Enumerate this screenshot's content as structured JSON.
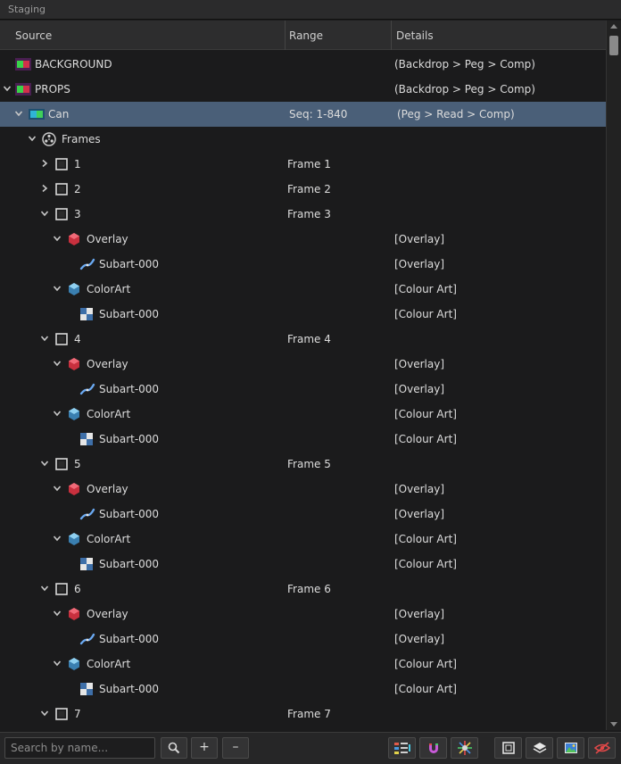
{
  "window": {
    "title": "Staging"
  },
  "columns": {
    "source": "Source",
    "range": "Range",
    "details": "Details"
  },
  "rows": [
    {
      "name": "BACKGROUND",
      "range": "",
      "details": "(Backdrop > Peg > Comp)",
      "icon": "element-color-icon",
      "chevron": "none",
      "depth": 0,
      "selected": false
    },
    {
      "name": "PROPS",
      "range": "",
      "details": "(Backdrop > Peg > Comp)",
      "icon": "element-color-icon",
      "chevron": "down",
      "depth": 0,
      "selected": false
    },
    {
      "name": "Can",
      "range": "Seq: 1-840",
      "details": "(Peg > Read > Comp)",
      "icon": "drawing-element-icon",
      "chevron": "down",
      "depth": 1,
      "selected": true
    },
    {
      "name": "Frames",
      "range": "",
      "details": "",
      "icon": "film-reel-icon",
      "chevron": "down",
      "depth": 2,
      "selected": false
    },
    {
      "name": "1",
      "range": "Frame 1",
      "details": "",
      "icon": "frame-icon",
      "chevron": "right",
      "depth": 3,
      "selected": false
    },
    {
      "name": "2",
      "range": "Frame 2",
      "details": "",
      "icon": "frame-icon",
      "chevron": "right",
      "depth": 3,
      "selected": false
    },
    {
      "name": "3",
      "range": "Frame 3",
      "details": "",
      "icon": "frame-icon",
      "chevron": "down",
      "depth": 3,
      "selected": false
    },
    {
      "name": "Overlay",
      "range": "",
      "details": "[Overlay]",
      "icon": "overlay-layer-icon",
      "chevron": "down",
      "depth": 4,
      "selected": false
    },
    {
      "name": "Subart-000",
      "range": "",
      "details": "[Overlay]",
      "icon": "vector-stroke-icon",
      "chevron": "none",
      "depth": 5,
      "selected": false
    },
    {
      "name": "ColorArt",
      "range": "",
      "details": "[Colour Art]",
      "icon": "colorart-layer-icon",
      "chevron": "down",
      "depth": 4,
      "selected": false
    },
    {
      "name": "Subart-000",
      "range": "",
      "details": "[Colour Art]",
      "icon": "checker-fill-icon",
      "chevron": "none",
      "depth": 5,
      "selected": false
    },
    {
      "name": "4",
      "range": "Frame 4",
      "details": "",
      "icon": "frame-icon",
      "chevron": "down",
      "depth": 3,
      "selected": false
    },
    {
      "name": "Overlay",
      "range": "",
      "details": "[Overlay]",
      "icon": "overlay-layer-icon",
      "chevron": "down",
      "depth": 4,
      "selected": false
    },
    {
      "name": "Subart-000",
      "range": "",
      "details": "[Overlay]",
      "icon": "vector-stroke-icon",
      "chevron": "none",
      "depth": 5,
      "selected": false
    },
    {
      "name": "ColorArt",
      "range": "",
      "details": "[Colour Art]",
      "icon": "colorart-layer-icon",
      "chevron": "down",
      "depth": 4,
      "selected": false
    },
    {
      "name": "Subart-000",
      "range": "",
      "details": "[Colour Art]",
      "icon": "checker-fill-icon",
      "chevron": "none",
      "depth": 5,
      "selected": false
    },
    {
      "name": "5",
      "range": "Frame 5",
      "details": "",
      "icon": "frame-icon",
      "chevron": "down",
      "depth": 3,
      "selected": false
    },
    {
      "name": "Overlay",
      "range": "",
      "details": "[Overlay]",
      "icon": "overlay-layer-icon",
      "chevron": "down",
      "depth": 4,
      "selected": false
    },
    {
      "name": "Subart-000",
      "range": "",
      "details": "[Overlay]",
      "icon": "vector-stroke-icon",
      "chevron": "none",
      "depth": 5,
      "selected": false
    },
    {
      "name": "ColorArt",
      "range": "",
      "details": "[Colour Art]",
      "icon": "colorart-layer-icon",
      "chevron": "down",
      "depth": 4,
      "selected": false
    },
    {
      "name": "Subart-000",
      "range": "",
      "details": "[Colour Art]",
      "icon": "checker-fill-icon",
      "chevron": "none",
      "depth": 5,
      "selected": false
    },
    {
      "name": "6",
      "range": "Frame 6",
      "details": "",
      "icon": "frame-icon",
      "chevron": "down",
      "depth": 3,
      "selected": false
    },
    {
      "name": "Overlay",
      "range": "",
      "details": "[Overlay]",
      "icon": "overlay-layer-icon",
      "chevron": "down",
      "depth": 4,
      "selected": false
    },
    {
      "name": "Subart-000",
      "range": "",
      "details": "[Overlay]",
      "icon": "vector-stroke-icon",
      "chevron": "none",
      "depth": 5,
      "selected": false
    },
    {
      "name": "ColorArt",
      "range": "",
      "details": "[Colour Art]",
      "icon": "colorart-layer-icon",
      "chevron": "down",
      "depth": 4,
      "selected": false
    },
    {
      "name": "Subart-000",
      "range": "",
      "details": "[Colour Art]",
      "icon": "checker-fill-icon",
      "chevron": "none",
      "depth": 5,
      "selected": false
    },
    {
      "name": "7",
      "range": "Frame 7",
      "details": "",
      "icon": "frame-icon",
      "chevron": "down",
      "depth": 3,
      "selected": false
    }
  ],
  "search": {
    "placeholder": "Search by name...",
    "value": ""
  },
  "toolbar": {
    "add_label": "+",
    "remove_label": "–",
    "icons": [
      "element-list-icon",
      "magnet-icon",
      "color-sparkle-icon",
      "frame-view-icon",
      "layers-icon",
      "image-icon",
      "hide-eye-icon"
    ]
  },
  "colors": {
    "selection": "#4a5f78",
    "background": "#1b1b1c",
    "header": "#2d2d2e"
  }
}
